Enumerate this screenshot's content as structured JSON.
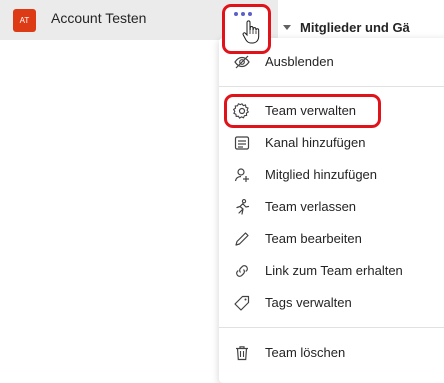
{
  "team": {
    "avatar_initials": "AT",
    "name": "Account Testen",
    "avatar_color": "#dc3b15"
  },
  "header": {
    "section_title": "Mitglieder und Gä"
  },
  "menu": {
    "items": [
      {
        "label": "Ausblenden",
        "icon": "hide-icon"
      },
      {
        "label": "Team verwalten",
        "icon": "gear-icon"
      },
      {
        "label": "Kanal hinzufügen",
        "icon": "add-channel-icon"
      },
      {
        "label": "Mitglied hinzufügen",
        "icon": "add-member-icon"
      },
      {
        "label": "Team verlassen",
        "icon": "leave-team-icon"
      },
      {
        "label": "Team bearbeiten",
        "icon": "pencil-icon"
      },
      {
        "label": "Link zum Team erhalten",
        "icon": "link-icon"
      },
      {
        "label": "Tags verwalten",
        "icon": "tag-icon"
      },
      {
        "label": "Team löschen",
        "icon": "trash-icon"
      }
    ]
  },
  "colors": {
    "accent": "#5b5fc7",
    "highlight_red": "#e0131b"
  }
}
